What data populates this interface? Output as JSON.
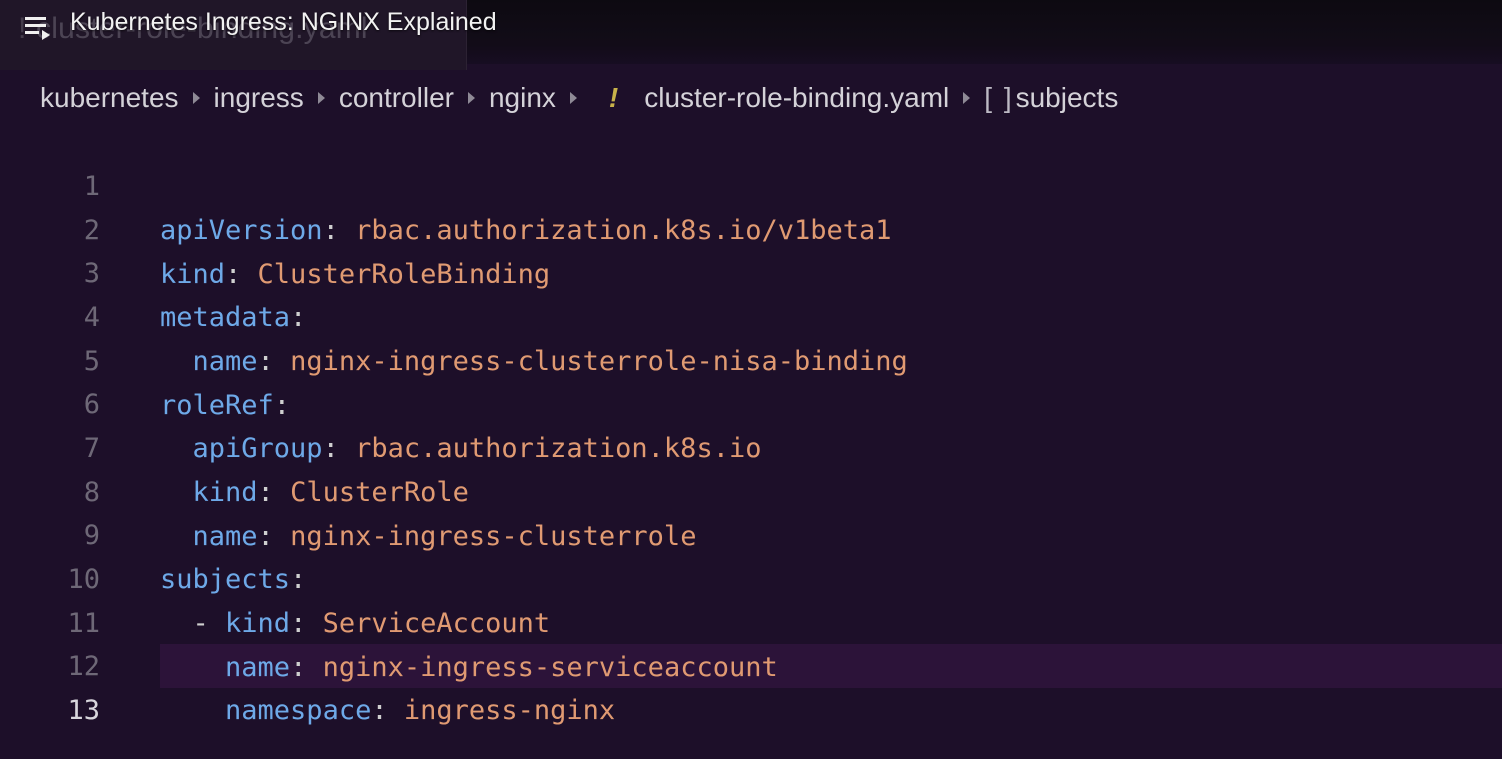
{
  "video": {
    "title": "Kubernetes Ingress: NGINX Explained",
    "menu_icon": "playlist-menu-icon"
  },
  "tab": {
    "ghost_bang": "!",
    "ghost_label": "cluster-role-binding.yaml"
  },
  "breadcrumb": {
    "items": [
      "kubernetes",
      "ingress",
      "controller",
      "nginx"
    ],
    "yaml_icon": "!",
    "file": "cluster-role-binding.yaml",
    "symbol_icon": "[ ]",
    "symbol": "subjects"
  },
  "editor": {
    "active_line": 13,
    "lines": [
      {
        "num": "1",
        "indent": "",
        "key": "apiVersion",
        "sep": ": ",
        "value": "rbac.authorization.k8s.io/v1beta1"
      },
      {
        "num": "2",
        "indent": "",
        "key": "kind",
        "sep": ": ",
        "value": "ClusterRoleBinding"
      },
      {
        "num": "3",
        "indent": "",
        "key": "metadata",
        "sep": ":",
        "value": ""
      },
      {
        "num": "4",
        "indent": "  ",
        "key": "name",
        "sep": ": ",
        "value": "nginx-ingress-clusterrole-nisa-binding"
      },
      {
        "num": "5",
        "indent": "",
        "key": "roleRef",
        "sep": ":",
        "value": ""
      },
      {
        "num": "6",
        "indent": "  ",
        "key": "apiGroup",
        "sep": ": ",
        "value": "rbac.authorization.k8s.io"
      },
      {
        "num": "7",
        "indent": "  ",
        "key": "kind",
        "sep": ": ",
        "value": "ClusterRole"
      },
      {
        "num": "8",
        "indent": "  ",
        "key": "name",
        "sep": ": ",
        "value": "nginx-ingress-clusterrole"
      },
      {
        "num": "9",
        "indent": "",
        "key": "subjects",
        "sep": ":",
        "value": ""
      },
      {
        "num": "10",
        "indent": "  - ",
        "key": "kind",
        "sep": ": ",
        "value": "ServiceAccount"
      },
      {
        "num": "11",
        "indent": "    ",
        "key": "name",
        "sep": ": ",
        "value": "nginx-ingress-serviceaccount"
      },
      {
        "num": "12",
        "indent": "    ",
        "key": "namespace",
        "sep": ": ",
        "value": "ingress-nginx"
      },
      {
        "num": "13",
        "indent": "",
        "key": "",
        "sep": "",
        "value": ""
      }
    ]
  }
}
